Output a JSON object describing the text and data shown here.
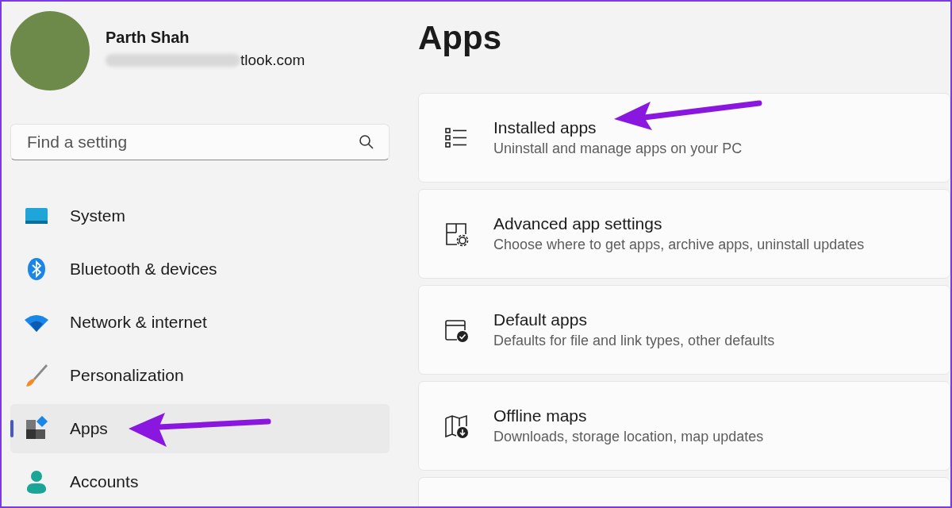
{
  "account": {
    "name": "Parth Shah",
    "email": "tlook.com"
  },
  "search": {
    "placeholder": "Find a setting"
  },
  "nav": [
    {
      "label": "System",
      "kind": "system",
      "selected": false
    },
    {
      "label": "Bluetooth & devices",
      "kind": "bluetooth",
      "selected": false
    },
    {
      "label": "Network & internet",
      "kind": "network",
      "selected": false
    },
    {
      "label": "Personalization",
      "kind": "brush",
      "selected": false
    },
    {
      "label": "Apps",
      "kind": "apps",
      "selected": true
    },
    {
      "label": "Accounts",
      "kind": "accounts",
      "selected": false
    }
  ],
  "page_title": "Apps",
  "cards": [
    {
      "kind": "list",
      "title": "Installed apps",
      "subtitle": "Uninstall and manage apps on your PC"
    },
    {
      "kind": "gear",
      "title": "Advanced app settings",
      "subtitle": "Choose where to get apps, archive apps, uninstall updates"
    },
    {
      "kind": "check",
      "title": "Default apps",
      "subtitle": "Defaults for file and link types, other defaults"
    },
    {
      "kind": "map",
      "title": "Offline maps",
      "subtitle": "Downloads, storage location, map updates"
    },
    {
      "kind": "blank"
    }
  ]
}
